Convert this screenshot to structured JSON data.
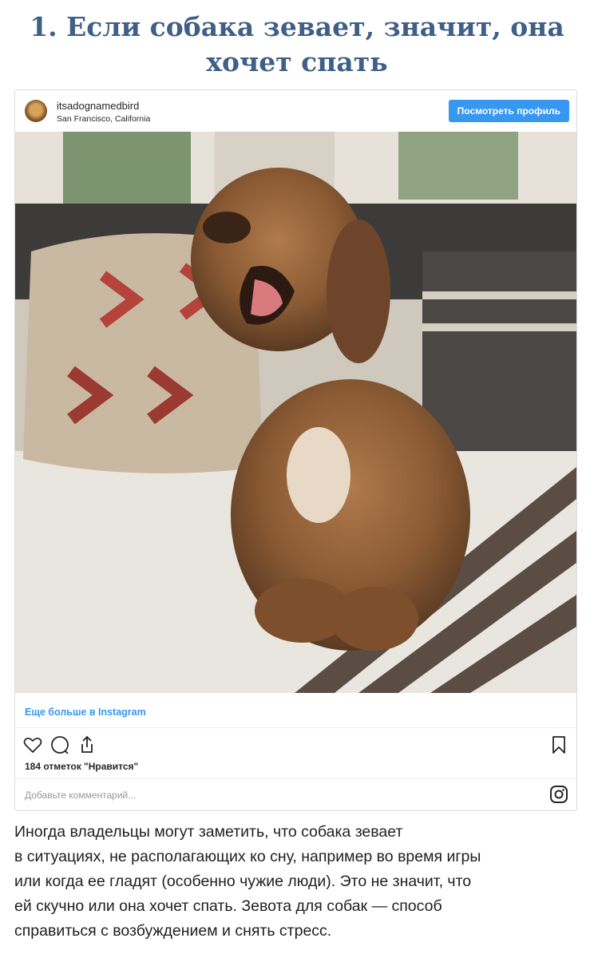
{
  "article": {
    "title": "1. Если собака зевает, значит, она хочет спать",
    "body": "Иногда владельцы могут заметить, что собака зевает\nв ситуациях, не располагающих ко сну, например во время игры\nили когда ее гладят (особенно чужие люди). Это не значит, что\nей скучно или она хочет спать. Зевота для собак — способ\nсправиться с возбуждением и снять стресс."
  },
  "post": {
    "username": "itsadognamedbird",
    "location": "San Francisco, California",
    "view_profile_label": "Посмотреть профиль",
    "more_link": "Еще больше в Instagram",
    "likes_text": "184 отметок \"Нравится\"",
    "comment_placeholder": "Добавьте комментарий...",
    "photo_subject": "yawning curly brown puppy on a couch",
    "icons": [
      "heart-icon",
      "comment-icon",
      "share-icon",
      "bookmark-icon",
      "instagram-icon"
    ]
  },
  "colors": {
    "title": "#3f5f87",
    "button": "#3897f0",
    "link": "#3897f0"
  }
}
